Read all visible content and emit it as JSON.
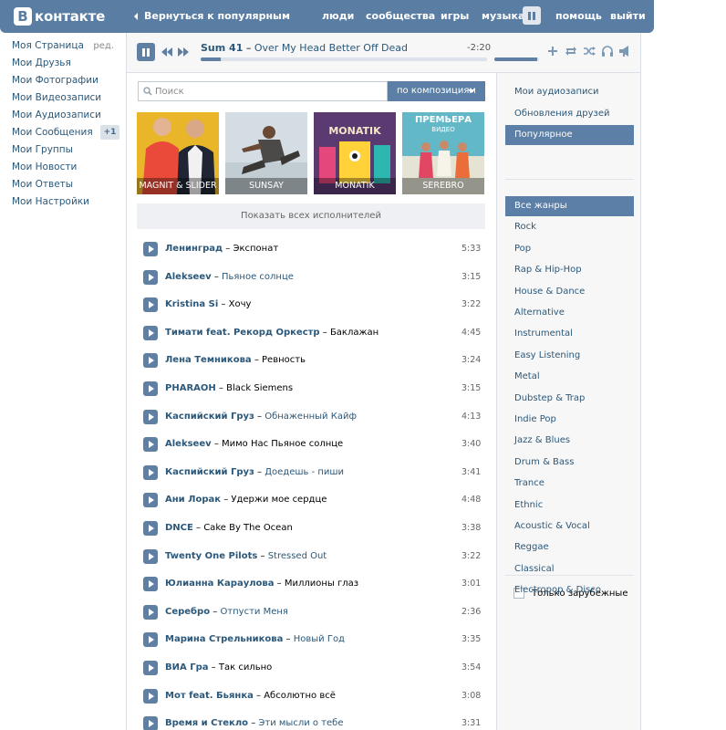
{
  "header": {
    "logo_letter": "В",
    "logo_text": "контакте",
    "back_label": "Вернуться к популярным",
    "nav": [
      "люди",
      "сообщества",
      "игры",
      "музыка",
      "помощь",
      "выйти"
    ]
  },
  "leftmenu": {
    "items": [
      {
        "label": "Моя Страница",
        "extra": "ред."
      },
      {
        "label": "Мои Друзья"
      },
      {
        "label": "Мои Фотографии"
      },
      {
        "label": "Мои Видеозаписи"
      },
      {
        "label": "Мои Аудиозаписи"
      },
      {
        "label": "Мои Сообщения",
        "badge": "+1"
      },
      {
        "label": "Мои Группы"
      },
      {
        "label": "Мои Новости"
      },
      {
        "label": "Мои Ответы"
      },
      {
        "label": "Мои Настройки"
      }
    ]
  },
  "player": {
    "artist": "Sum 41",
    "dash": " – ",
    "song": "Over My Head Better Off Dead",
    "time": "-2:20",
    "progress": 0.07,
    "volume": 0.95,
    "icons": [
      "pause-icon",
      "prev-icon",
      "next-icon",
      "add-icon",
      "repeat-icon",
      "shuffle-icon",
      "headphones-icon",
      "broadcast-icon"
    ]
  },
  "search": {
    "placeholder": "Поиск",
    "mode": "по композициям"
  },
  "artists": [
    {
      "name": "MAGNIT & SLIDER",
      "color": "#e6b022"
    },
    {
      "name": "SUNSAY",
      "color": "#c9d5de"
    },
    {
      "name": "MONATIK",
      "color": "#5b3a72"
    },
    {
      "name": "SEREBRO",
      "color": "#5bb4c4",
      "overlay_title": "ПРЕМЬЕРА",
      "overlay_sub": "ВИДЕО"
    }
  ],
  "show_all": "Показать всех исполнителей",
  "tracks": [
    {
      "artist": "Ленинград",
      "song": "Экспонат",
      "link": false,
      "dur": "5:33"
    },
    {
      "artist": "Alekseev",
      "song": "Пьяное солнце",
      "link": true,
      "dur": "3:15"
    },
    {
      "artist": "Kristina Si",
      "song": "Хочу",
      "link": false,
      "dur": "3:22"
    },
    {
      "artist": "Тимати feat. Рекорд Оркестр",
      "song": "Баклажан",
      "link": false,
      "dur": "4:45"
    },
    {
      "artist": "Лена Темникова",
      "song": "Ревность",
      "link": false,
      "dur": "3:24"
    },
    {
      "artist": "PHARAOH",
      "song": "Black Siemens",
      "link": false,
      "dur": "3:15"
    },
    {
      "artist": "Каспийский Груз",
      "song": "Обнаженный Кайф",
      "link": true,
      "dur": "4:13"
    },
    {
      "artist": "Alekseev",
      "song": "Мимо Нас Пьяное солнце",
      "link": false,
      "dur": "3:40"
    },
    {
      "artist": "Каспийский Груз",
      "song": "Доедешь - пиши",
      "link": true,
      "dur": "3:41"
    },
    {
      "artist": "Ани Лорак",
      "song": "Удержи мое сердце",
      "link": false,
      "dur": "4:48"
    },
    {
      "artist": "DNCE",
      "song": "Cake By The Ocean",
      "link": false,
      "dur": "3:38"
    },
    {
      "artist": "Twenty One Pilots",
      "song": "Stressed Out",
      "link": true,
      "dur": "3:22"
    },
    {
      "artist": "Юлианна Караулова",
      "song": "Миллионы глаз",
      "link": false,
      "dur": "3:01"
    },
    {
      "artist": "Серебро",
      "song": "Отпусти Меня",
      "link": true,
      "dur": "2:36"
    },
    {
      "artist": "Марина Стрельникова",
      "song": "Новый Год",
      "link": true,
      "dur": "3:35"
    },
    {
      "artist": "ВИА Гра",
      "song": "Так сильно",
      "link": false,
      "dur": "3:54"
    },
    {
      "artist": "Мот feat. Бьянка",
      "song": "Абсолютно всё",
      "link": false,
      "dur": "3:08"
    },
    {
      "artist": "Время и Стекло",
      "song": "Эти мысли о тебе",
      "link": true,
      "dur": "3:31"
    }
  ],
  "right": {
    "top_items": [
      "Мои аудиозаписи",
      "Обновления друзей",
      "Популярное"
    ],
    "top_active": 2,
    "genres": [
      "Все жанры",
      "Rock",
      "Pop",
      "Rap & Hip-Hop",
      "House & Dance",
      "Alternative",
      "Instrumental",
      "Easy Listening",
      "Metal",
      "Dubstep & Trap",
      "Indie Pop",
      "Jazz & Blues",
      "Drum & Bass",
      "Trance",
      "Ethnic",
      "Acoustic & Vocal",
      "Reggae",
      "Classical",
      "Electropop & Disco"
    ],
    "genres_active": 0,
    "foreign_only": "Только зарубежные"
  }
}
